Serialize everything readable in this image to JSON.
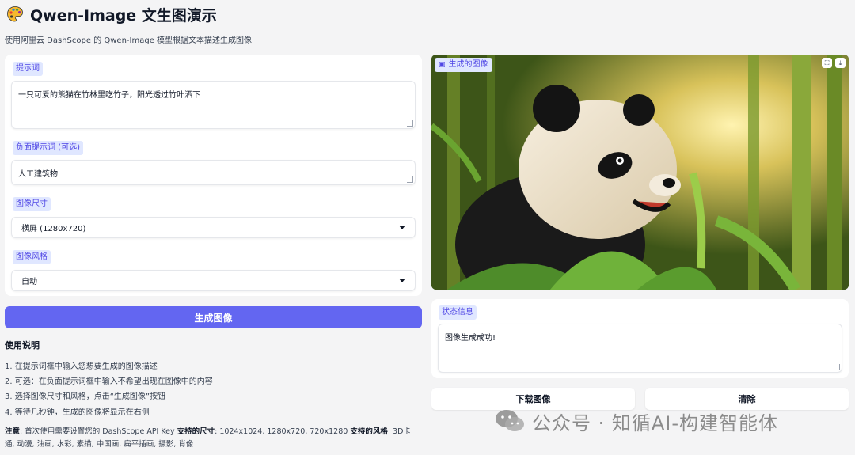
{
  "header": {
    "title": "Qwen-Image 文生图演示",
    "subtitle": "使用阿里云 DashScope 的 Qwen-Image 模型根据文本描述生成图像"
  },
  "form": {
    "prompt_label": "提示词",
    "prompt_value": "一只可爱的熊猫在竹林里吃竹子，阳光透过竹叶洒下",
    "negative_label": "负面提示词 (可选)",
    "negative_value": "人工建筑物",
    "size_label": "图像尺寸",
    "size_value": "横屏 (1280x720)",
    "style_label": "图像风格",
    "style_value": "自动",
    "generate_label": "生成图像"
  },
  "instructions": {
    "heading": "使用说明",
    "items": [
      "1. 在提示词框中输入您想要生成的图像描述",
      "2. 可选：在负面提示词框中输入不希望出现在图像中的内容",
      "3. 选择图像尺寸和风格，点击“生成图像”按钮",
      "4. 等待几秒钟，生成的图像将显示在右侧"
    ],
    "note_prefix": "注意",
    "note_text": ": 首次使用需要设置您的 DashScope API Key ",
    "sizes_label": "支持的尺寸",
    "sizes_text": ": 1024x1024, 1280x720, 720x1280 ",
    "styles_label": "支持的风格",
    "styles_text": ": 3D卡通, 动漫, 油画, 水彩, 素描, 中国画, 扁平插画, 摄影, 肖像"
  },
  "output": {
    "image_label": "生成的图像",
    "fullscreen_icon": "fullscreen-icon",
    "download_icon": "download-icon",
    "status_label": "状态信息",
    "status_value": "图像生成成功!",
    "download_button": "下载图像",
    "clear_button": "清除"
  },
  "watermark": {
    "text": "公众号 · 知循AI-构建智能体"
  },
  "colors": {
    "accent": "#6366f1",
    "label_bg": "#e0e7ff",
    "label_text": "#4f46e5"
  }
}
